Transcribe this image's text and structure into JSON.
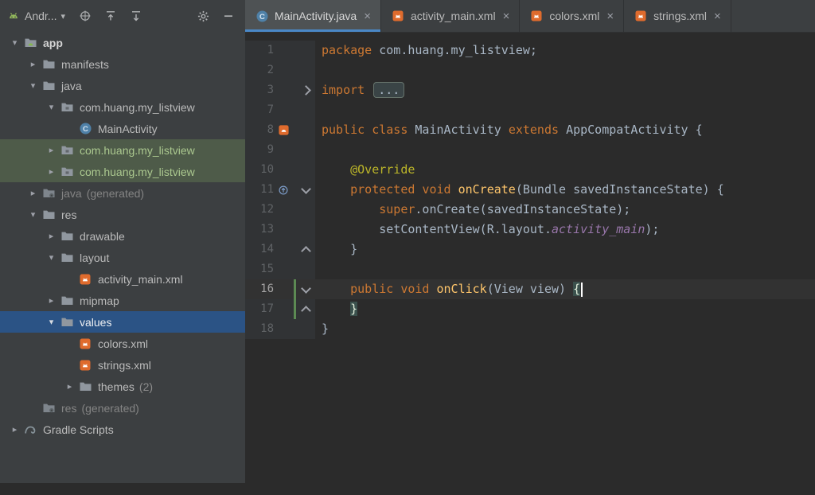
{
  "colors": {
    "accent_blue": "#4A88C7",
    "selection_blue": "#2B5385",
    "selection_green": "#4E5B49",
    "keyword": "#CC7832",
    "annotation": "#BBB529",
    "method": "#FFC66B",
    "field": "#9876AA",
    "plain_text": "#A9B7C6",
    "editor_bg": "#2B2B2B",
    "panel_bg": "#3C3F41"
  },
  "glyphs": {
    "chevron_down": "▾",
    "chevron_right": "▸",
    "close": "×"
  },
  "panel_toolbar": {
    "view_selector": {
      "label": "Andr...",
      "icon": "android-logo"
    },
    "actions": [
      {
        "name": "locate"
      },
      {
        "name": "collapse-all"
      },
      {
        "name": "expand-all"
      },
      {
        "name": "settings"
      },
      {
        "name": "hide-panel"
      }
    ]
  },
  "project_tree": {
    "items": [
      {
        "label": "app",
        "level": 0,
        "chevron": "down",
        "icon": "android-folder",
        "bold": true
      },
      {
        "label": "manifests",
        "level": 1,
        "chevron": "right",
        "icon": "folder"
      },
      {
        "label": "java",
        "level": 1,
        "chevron": "down",
        "icon": "folder"
      },
      {
        "label": "com.huang.my_listview",
        "level": 2,
        "chevron": "down",
        "icon": "package"
      },
      {
        "label": "MainActivity",
        "level": 3,
        "chevron": "none",
        "icon": "class"
      },
      {
        "label": "com.huang.my_listview",
        "level": 2,
        "chevron": "right",
        "icon": "package",
        "state": "green"
      },
      {
        "label": "com.huang.my_listview",
        "level": 2,
        "chevron": "right",
        "icon": "package",
        "state": "green"
      },
      {
        "label": "java",
        "suffix": "(generated)",
        "level": 1,
        "chevron": "right",
        "icon": "gen-folder",
        "dim": true
      },
      {
        "label": "res",
        "level": 1,
        "chevron": "down",
        "icon": "folder"
      },
      {
        "label": "drawable",
        "level": 2,
        "chevron": "right",
        "icon": "folder"
      },
      {
        "label": "layout",
        "level": 2,
        "chevron": "down",
        "icon": "folder"
      },
      {
        "label": "activity_main.xml",
        "level": 3,
        "chevron": "none",
        "icon": "xml"
      },
      {
        "label": "mipmap",
        "level": 2,
        "chevron": "right",
        "icon": "folder"
      },
      {
        "label": "values",
        "level": 2,
        "chevron": "down",
        "icon": "folder",
        "state": "blue"
      },
      {
        "label": "colors.xml",
        "level": 3,
        "chevron": "none",
        "icon": "xml"
      },
      {
        "label": "strings.xml",
        "level": 3,
        "chevron": "none",
        "icon": "xml"
      },
      {
        "label": "themes",
        "suffix": "(2)",
        "level": 3,
        "chevron": "right",
        "icon": "folder"
      },
      {
        "label": "res",
        "suffix": "(generated)",
        "level": 1,
        "chevron": "none",
        "icon": "gen-folder",
        "dim": true
      },
      {
        "label": "Gradle Scripts",
        "level": 0,
        "chevron": "right",
        "icon": "gradle"
      }
    ]
  },
  "tabs": [
    {
      "label": "MainActivity.java",
      "icon": "class",
      "active": true
    },
    {
      "label": "activity_main.xml",
      "icon": "xml",
      "active": false
    },
    {
      "label": "colors.xml",
      "icon": "xml",
      "active": false
    },
    {
      "label": "strings.xml",
      "icon": "xml",
      "active": false
    }
  ],
  "editor": {
    "language": "java",
    "current_line": "16",
    "lines": [
      {
        "num": "1",
        "indent": 0,
        "tokens": [
          {
            "t": "kw",
            "s": "package"
          },
          {
            "t": "def",
            "s": " com.huang.my_listview;"
          }
        ]
      },
      {
        "num": "2",
        "tokens": []
      },
      {
        "num": "3",
        "indent": 0,
        "fold": "collapsed",
        "tokens": [
          {
            "t": "kw",
            "s": "import "
          },
          {
            "t": "fold",
            "s": "..."
          }
        ]
      },
      {
        "num": "7",
        "tokens": []
      },
      {
        "num": "8",
        "indent": 0,
        "gutter_icon": "gutter-android",
        "tokens": [
          {
            "t": "kw",
            "s": "public class "
          },
          {
            "t": "def",
            "s": "MainActivity "
          },
          {
            "t": "kw",
            "s": "extends "
          },
          {
            "t": "def",
            "s": "AppCompatActivity {"
          }
        ]
      },
      {
        "num": "9",
        "tokens": []
      },
      {
        "num": "10",
        "indent": 1,
        "tokens": [
          {
            "t": "ann",
            "s": "@Override"
          }
        ]
      },
      {
        "num": "11",
        "indent": 1,
        "gutter_icon": "override",
        "fold": "start",
        "tokens": [
          {
            "t": "kw",
            "s": "protected void "
          },
          {
            "t": "m",
            "s": "onCreate"
          },
          {
            "t": "def",
            "s": "(Bundle savedInstanceState) {"
          }
        ]
      },
      {
        "num": "12",
        "indent": 2,
        "tokens": [
          {
            "t": "kw",
            "s": "super"
          },
          {
            "t": "def",
            "s": ".onCreate(savedInstanceState);"
          }
        ]
      },
      {
        "num": "13",
        "indent": 2,
        "tokens": [
          {
            "t": "def",
            "s": "setContentView(R.layout."
          },
          {
            "t": "f",
            "s": "activity_main"
          },
          {
            "t": "def",
            "s": ");"
          }
        ]
      },
      {
        "num": "14",
        "indent": 1,
        "fold": "end",
        "tokens": [
          {
            "t": "def",
            "s": "}"
          }
        ]
      },
      {
        "num": "15",
        "tokens": []
      },
      {
        "num": "16",
        "indent": 1,
        "current": true,
        "changed": true,
        "fold": "start",
        "tokens": [
          {
            "t": "kw",
            "s": "public void "
          },
          {
            "t": "m",
            "s": "onClick"
          },
          {
            "t": "def",
            "s": "(View view) "
          },
          {
            "t": "brace",
            "s": "{"
          },
          {
            "t": "caret"
          }
        ]
      },
      {
        "num": "17",
        "indent": 1,
        "changed": true,
        "fold": "end",
        "tokens": [
          {
            "t": "brace",
            "s": "}"
          }
        ]
      },
      {
        "num": "18",
        "indent": 0,
        "tokens": [
          {
            "t": "def",
            "s": "}"
          }
        ]
      }
    ]
  }
}
